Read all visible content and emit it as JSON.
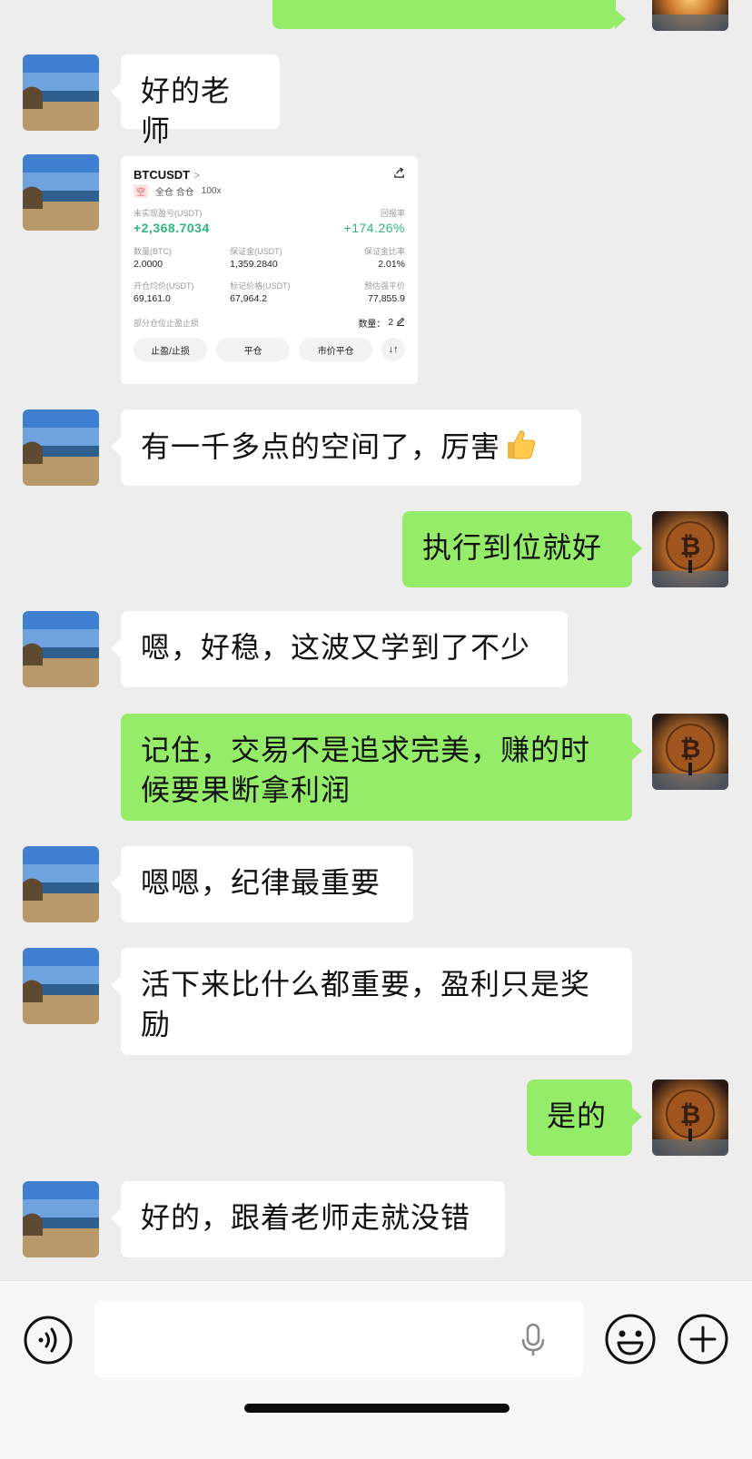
{
  "messages": [
    {
      "side": "left",
      "text": "好的老师"
    },
    {
      "side": "left",
      "kind": "card"
    },
    {
      "side": "left",
      "text": "有一千多点的空间了，厉害",
      "emoji": "thumbs-up"
    },
    {
      "side": "right",
      "text": "执行到位就好"
    },
    {
      "side": "left",
      "text": "嗯，好稳，这波又学到了不少"
    },
    {
      "side": "right",
      "text": "记住，交易不是追求完美，赚的时候要果断拿利润"
    },
    {
      "side": "left",
      "text": "嗯嗯，纪律最重要"
    },
    {
      "side": "left",
      "text": "活下来比什么都重要，盈利只是奖励"
    },
    {
      "side": "right",
      "text": "是的"
    },
    {
      "side": "left",
      "text": "好的，跟着老师走就没错"
    }
  ],
  "card": {
    "symbol": "BTCUSDT",
    "chevron": ">",
    "side_tag": "空",
    "margin_mode": "全仓 合仓",
    "leverage": "100x",
    "unrealized_label": "未实现盈亏(USDT)",
    "unrealized_value": "+2,368.7034",
    "roi_label": "回报率",
    "roi_value": "+174.26%",
    "qty_label": "数量(BTC)",
    "qty_value": "2.0000",
    "margin_label": "保证金(USDT)",
    "margin_value": "1,359.2840",
    "margin_ratio_label": "保证金比率",
    "margin_ratio_value": "2.01%",
    "entry_label": "开仓均价(USDT)",
    "entry_value": "69,161.0",
    "mark_label": "标记价格(USDT)",
    "mark_value": "67,964.2",
    "liq_label": "预估强平价",
    "liq_value": "77,855.9",
    "partial_label": "部分仓位止盈止损",
    "count_label": "数量：",
    "count_value": "2",
    "btn_tpsl": "止盈/止损",
    "btn_close": "平仓",
    "btn_market_close": "市价平仓",
    "btn_swap": "↓↑"
  },
  "colors": {
    "background": "#ededed",
    "bubble_white": "#ffffff",
    "bubble_green": "#95ec69",
    "profit_green": "#2eb67d"
  },
  "icons": {
    "voice_toggle": "voice-icon",
    "microphone": "microphone-icon",
    "emoji": "smiley-icon",
    "more": "plus-circle-icon"
  }
}
